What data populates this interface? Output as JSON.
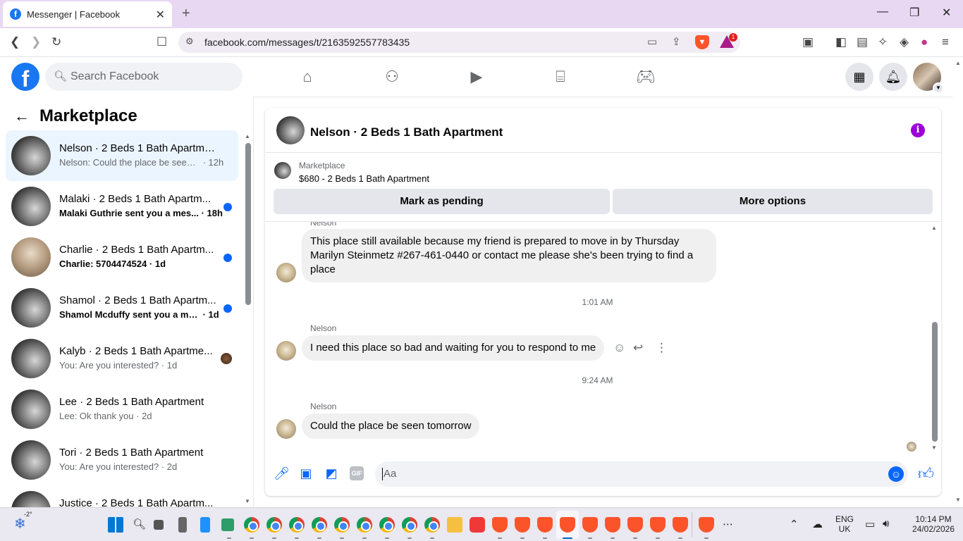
{
  "browser": {
    "tab_title": "Messenger | Facebook",
    "tab_favicon": "f",
    "url": "facebook.com/messages/t/2163592557783435",
    "rewards_badge": "1"
  },
  "fb": {
    "logo": "f",
    "search_placeholder": "Search Facebook"
  },
  "sidebar": {
    "title": "Marketplace",
    "conversations": [
      {
        "title": "Nelson · 2 Beds 1 Bath Apartment",
        "preview": "Nelson: Could the place be seen t...",
        "time": " · 12h",
        "unread": false,
        "active": true
      },
      {
        "title": "Malaki · 2 Beds 1 Bath Apartm...",
        "preview": "Malaki Guthrie sent you a mes...",
        "time": " · 18h",
        "unread": true
      },
      {
        "title": "Charlie · 2 Beds 1 Bath Apartm...",
        "preview": "Charlie: 5704474524",
        "time": " · 1d",
        "unread": true
      },
      {
        "title": "Shamol · 2 Beds 1 Bath Apartm...",
        "preview": "Shamol Mcduffy sent you a mes...",
        "time": " · 1d",
        "unread": true
      },
      {
        "title": "Kalyb · 2 Beds 1 Bath Apartme...",
        "preview": "You: Are you interested?",
        "time": " · 1d",
        "unread": false
      },
      {
        "title": "Lee · 2 Beds 1 Bath Apartment",
        "preview": "Lee: Ok thank you",
        "time": " · 2d",
        "unread": false
      },
      {
        "title": "Tori · 2 Beds 1 Bath Apartment",
        "preview": "You: Are you interested?",
        "time": " · 2d",
        "unread": false
      },
      {
        "title": "Justice · 2 Beds 1 Bath Apartm...",
        "preview": "",
        "time": "",
        "unread": false
      }
    ]
  },
  "chat": {
    "title": "Nelson · 2 Beds 1 Bath Apartment",
    "info_icon": "i",
    "marketplace_label": "Marketplace",
    "product": "$680 - 2 Beds 1 Bath Apartment",
    "mark_pending": "Mark as pending",
    "more_options": "More options",
    "sender_top": "Nelson",
    "msg1": "This place still available because my friend is prepared to move in by Thursday Marilyn Steinmetz #267-461-0440 or contact me please she's been trying to find a place",
    "ts1": "1:01 AM",
    "sender2": "Nelson",
    "msg2": "I need this place so bad and waiting for you to respond to me",
    "ts2": "9:24 AM",
    "sender3": "Nelson",
    "msg3": "Could the place be seen tomorrow",
    "composer_placeholder": "Aa",
    "gif_label": "GIF"
  },
  "taskbar": {
    "weather_temp": "-2°",
    "lang_line1": "ENG",
    "lang_line2": "UK",
    "time": "10:14 PM",
    "date": "24/02/2026"
  },
  "colors": {
    "fb_blue": "#1877f2",
    "messenger_blue": "#0866ff",
    "info_purple": "#9b00d9",
    "active_conv_bg": "#ebf5ff",
    "tabstrip": "#e8d8f2"
  }
}
